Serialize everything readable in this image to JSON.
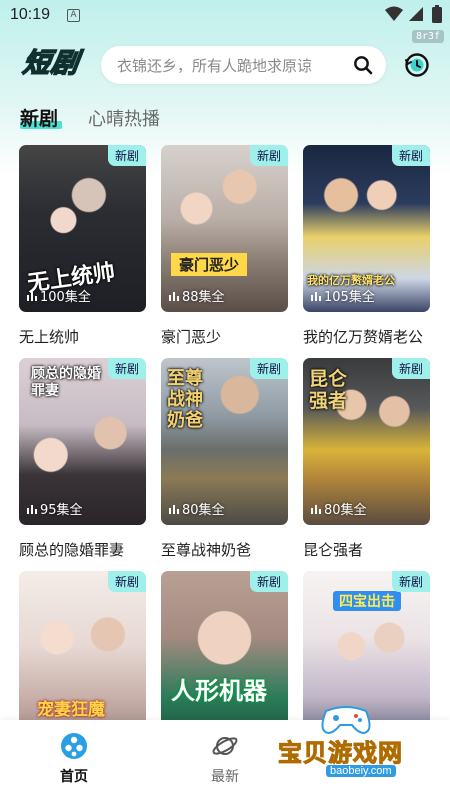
{
  "status_bar": {
    "time": "10:19",
    "notification_glyph": "A",
    "debug_tag": "8r3f"
  },
  "header": {
    "logo_text": "短剧",
    "search_placeholder": "衣锦还乡，所有人跪地求原谅"
  },
  "tabs": [
    {
      "label": "新剧",
      "active": true
    },
    {
      "label": "心晴热播",
      "active": false
    }
  ],
  "dramas": [
    {
      "name": "无上统帅",
      "badge": "新剧",
      "episodes": "100集全",
      "poster_text": "无上统帅"
    },
    {
      "name": "豪门恶少",
      "badge": "新剧",
      "episodes": "88集全",
      "poster_text": "豪门恶少"
    },
    {
      "name": "我的亿万赘婿老公",
      "badge": "新剧",
      "episodes": "105集全",
      "poster_text": "我的亿万赘婿老公"
    },
    {
      "name": "顾总的隐婚罪妻",
      "badge": "新剧",
      "episodes": "95集全",
      "poster_text": "顾总的隐婚罪妻"
    },
    {
      "name": "至尊战神奶爸",
      "badge": "新剧",
      "episodes": "80集全",
      "poster_text": "至尊战神奶爸"
    },
    {
      "name": "昆仑强者",
      "badge": "新剧",
      "episodes": "80集全",
      "poster_text": "昆仑强者"
    },
    {
      "name": "",
      "badge": "新剧",
      "episodes": "",
      "poster_text": "宠妻狂魔"
    },
    {
      "name": "",
      "badge": "新剧",
      "episodes": "",
      "poster_text": "人形机器"
    },
    {
      "name": "",
      "badge": "新剧",
      "episodes": "",
      "poster_text": "四宝出击"
    }
  ],
  "bottom_nav": [
    {
      "label": "首页",
      "icon": "film-reel-icon",
      "active": true
    },
    {
      "label": "最新",
      "icon": "planet-icon",
      "active": false
    }
  ],
  "watermark": {
    "text": "宝贝游戏网",
    "url": "baobeiy.com"
  },
  "colors": {
    "accent": "#4fe0d4",
    "badge_bg": "#9ff0ea",
    "nav_active": "#2a9fe6"
  }
}
